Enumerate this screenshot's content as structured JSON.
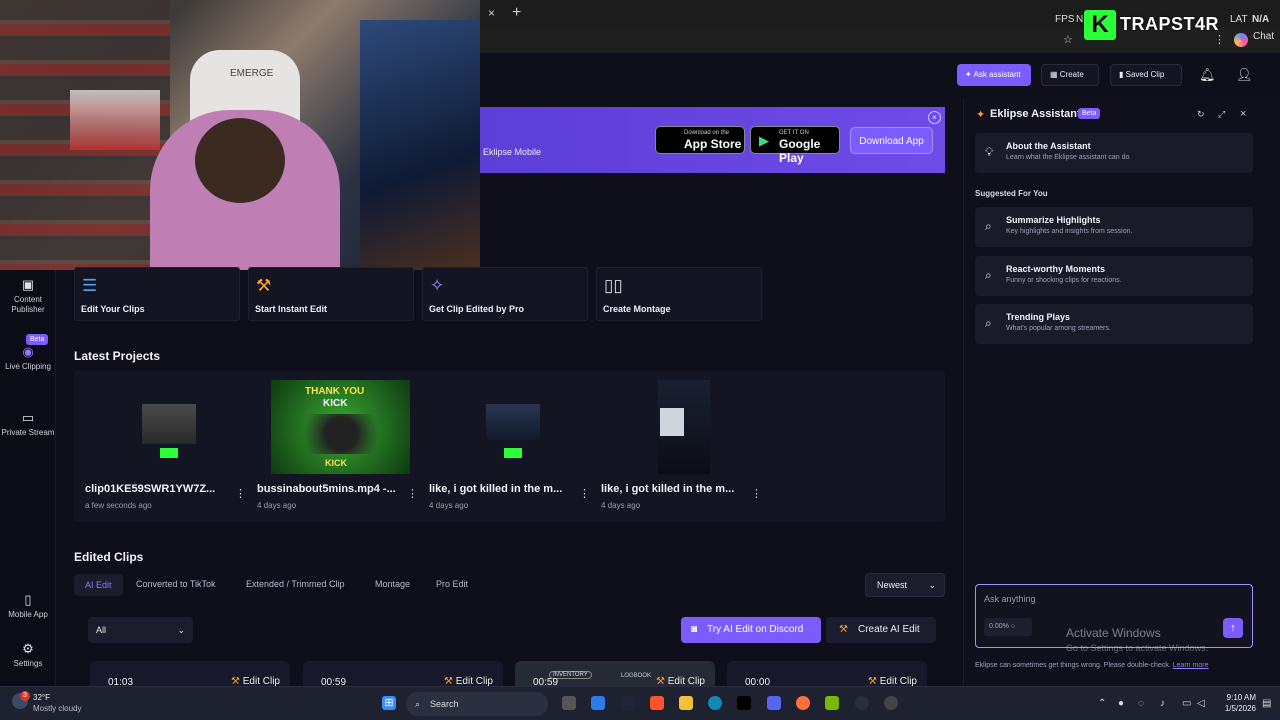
{
  "chrome": {
    "tab_close": "×",
    "tab_new": "+",
    "fps_label": "FPS",
    "fps_n": "N",
    "lat_label": "LAT",
    "lat_value": "N/A",
    "chat_label": "Chat",
    "streamer_logo": "K",
    "streamer_name": "TRAPST4R"
  },
  "webcam": {
    "chair_brand": "EMERGE"
  },
  "header": {
    "ask_assistant": "Ask assistant",
    "create": "Create",
    "saved_clip": "Saved Clip"
  },
  "banner": {
    "text": "Eklipse Mobile",
    "appstore_small": "Download on the",
    "appstore_big": "App Store",
    "gplay_small": "GET IT ON",
    "gplay_big": "Google Play",
    "download": "Download App",
    "close": "×"
  },
  "nav": {
    "content_publisher": "Content Publisher",
    "live_clipping": "Live Clipping",
    "live_beta": "Beta",
    "private_stream": "Private Stream",
    "mobile_app": "Mobile App",
    "settings": "Settings"
  },
  "quick_actions": [
    {
      "label": "Edit Your Clips",
      "icon": "sliders-icon"
    },
    {
      "label": "Start Instant Edit",
      "icon": "wand-icon"
    },
    {
      "label": "Get Clip Edited by Pro",
      "icon": "sparkle-icon"
    },
    {
      "label": "Create Montage",
      "icon": "montage-icon"
    }
  ],
  "latest_projects": {
    "title": "Latest Projects",
    "items": [
      {
        "title": "clip01KE59SWR1YW7Z...",
        "time": "a few seconds ago"
      },
      {
        "title": "bussinabout5mins.mp4 -...",
        "time": "4 days ago",
        "thumb_text_top": "THANK YOU",
        "thumb_text_mid": "KICK",
        "thumb_text_bottom": "KICK"
      },
      {
        "title": "like, i got killed in the m...",
        "time": "4 days ago"
      },
      {
        "title": "like, i got killed in the m...",
        "time": "4 days ago"
      }
    ]
  },
  "edited_clips": {
    "title": "Edited Clips",
    "tabs": [
      "AI Edit",
      "Converted to TikTok",
      "Extended / Trimmed Clip",
      "Montage",
      "Pro Edit"
    ],
    "sort": "Newest",
    "filter": "All",
    "discord_btn": "Try AI Edit on Discord",
    "create_ai_btn": "Create AI Edit",
    "cards": [
      {
        "time": "01:03",
        "edit": "Edit Clip"
      },
      {
        "time": "00:59",
        "edit": "Edit Clip"
      },
      {
        "time": "00:59",
        "edit": "Edit Clip",
        "overlay_a": "INVENTORY",
        "overlay_b": "LOGBOOK"
      },
      {
        "time": "00:00",
        "edit": "Edit Clip"
      }
    ]
  },
  "assistant": {
    "title": "Eklipse Assistant",
    "beta": "Beta",
    "about_title": "About the Assistant",
    "about_sub": "Learn what the Eklipse assistant can do",
    "suggested": "Suggested For You",
    "suggestions": [
      {
        "title": "Summarize Highlights",
        "sub": "Key highlights and insights from session."
      },
      {
        "title": "React-worthy Moments",
        "sub": "Funny or shocking clips for reactions."
      },
      {
        "title": "Trending Plays",
        "sub": "What's popular among streamers."
      }
    ],
    "ask_placeholder": "Ask anything",
    "usage": "0.00%",
    "disclaimer": "Eklipse can sometimes get things wrong. Please double-check.",
    "learn_more": "Learn more"
  },
  "windows": {
    "activate_title": "Activate Windows",
    "activate_sub": "Go to Settings to activate Windows.",
    "weather_temp": "32°F",
    "weather_desc": "Mostly cloudy",
    "weather_badge": "3",
    "search": "Search",
    "time": "9:10 AM",
    "date": "1/5/2026"
  }
}
